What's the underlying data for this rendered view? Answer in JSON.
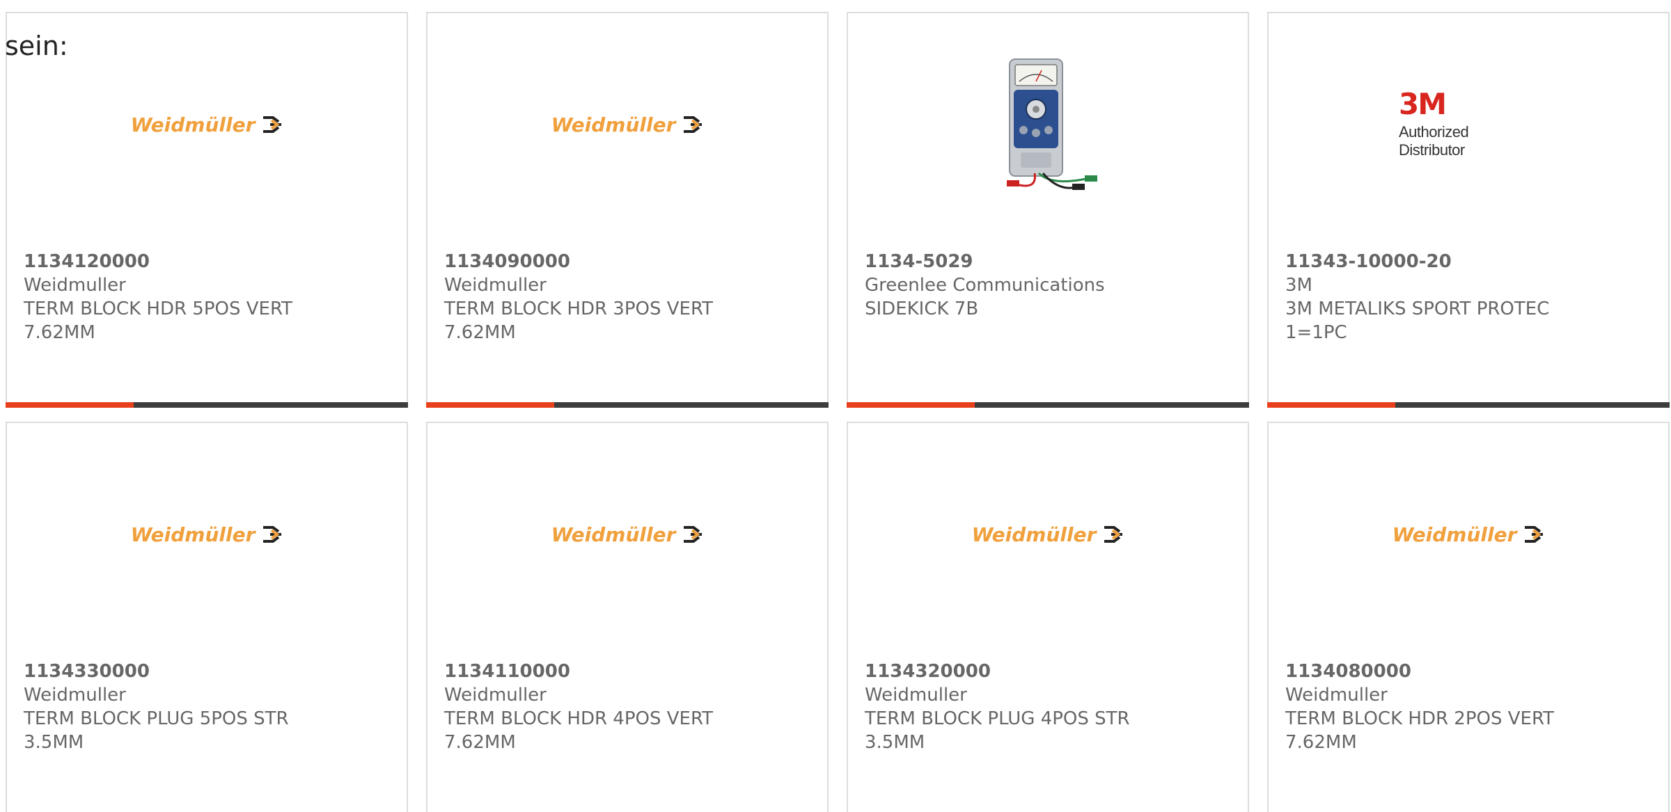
{
  "header_fragment": "sein:",
  "colors": {
    "accent": "#e8401c",
    "bar_dark": "#3d3d3d",
    "weidmuller_orange": "#f0a03c",
    "brand_3m_red": "#d8261f"
  },
  "products": [
    {
      "part_number": "1134120000",
      "manufacturer": "Weidmuller",
      "desc_line1": "TERM BLOCK HDR 5POS VERT",
      "desc_line2": "7.62MM",
      "image": {
        "type": "logo",
        "icon": "weidmuller-logo",
        "text": "Weidmüller"
      }
    },
    {
      "part_number": "1134090000",
      "manufacturer": "Weidmuller",
      "desc_line1": "TERM BLOCK HDR 3POS VERT",
      "desc_line2": "7.62MM",
      "image": {
        "type": "logo",
        "icon": "weidmuller-logo",
        "text": "Weidmüller"
      }
    },
    {
      "part_number": "1134-5029",
      "manufacturer": "Greenlee Communications",
      "desc_line1": "SIDEKICK 7B",
      "desc_line2": "",
      "image": {
        "type": "photo",
        "icon": "cable-tester-photo"
      }
    },
    {
      "part_number": "11343-10000-20",
      "manufacturer": "3M",
      "desc_line1": "3M METALIKS SPORT PROTEC",
      "desc_line2": "1=1PC",
      "image": {
        "type": "logo",
        "icon": "3m-logo",
        "text": "3M",
        "subtext": "Authorized Distributor"
      }
    },
    {
      "part_number": "1134330000",
      "manufacturer": "Weidmuller",
      "desc_line1": "TERM BLOCK PLUG 5POS STR",
      "desc_line2": "3.5MM",
      "image": {
        "type": "logo",
        "icon": "weidmuller-logo",
        "text": "Weidmüller"
      }
    },
    {
      "part_number": "1134110000",
      "manufacturer": "Weidmuller",
      "desc_line1": "TERM BLOCK HDR 4POS VERT",
      "desc_line2": "7.62MM",
      "image": {
        "type": "logo",
        "icon": "weidmuller-logo",
        "text": "Weidmüller"
      }
    },
    {
      "part_number": "1134320000",
      "manufacturer": "Weidmuller",
      "desc_line1": "TERM BLOCK PLUG 4POS STR",
      "desc_line2": "3.5MM",
      "image": {
        "type": "logo",
        "icon": "weidmuller-logo",
        "text": "Weidmüller"
      }
    },
    {
      "part_number": "1134080000",
      "manufacturer": "Weidmuller",
      "desc_line1": "TERM BLOCK HDR 2POS VERT",
      "desc_line2": "7.62MM",
      "image": {
        "type": "logo",
        "icon": "weidmuller-logo",
        "text": "Weidmüller"
      }
    }
  ]
}
